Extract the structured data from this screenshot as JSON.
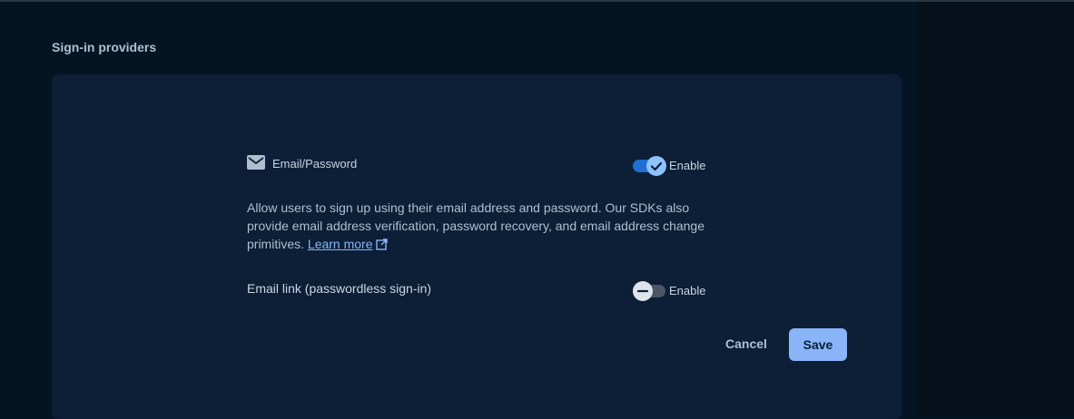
{
  "section": {
    "title": "Sign-in providers"
  },
  "providers": [
    {
      "label": "Email/Password",
      "icon": "mail-icon",
      "toggle_label": "Enable",
      "enabled": true
    },
    {
      "label": "Email link (passwordless sign-in)",
      "toggle_label": "Enable",
      "enabled": false
    }
  ],
  "description": {
    "text": "Allow users to sign up using their email address and password. Our SDKs also provide email address verification, password recovery, and email address change primitives.",
    "link_label": "Learn more",
    "link_icon": "external-link-icon"
  },
  "actions": {
    "cancel_label": "Cancel",
    "save_label": "Save"
  },
  "colors": {
    "accent": "#8ab4f8",
    "toggle_on": "#1e6fd1",
    "card": "#0c1f36",
    "background": "#051423"
  }
}
